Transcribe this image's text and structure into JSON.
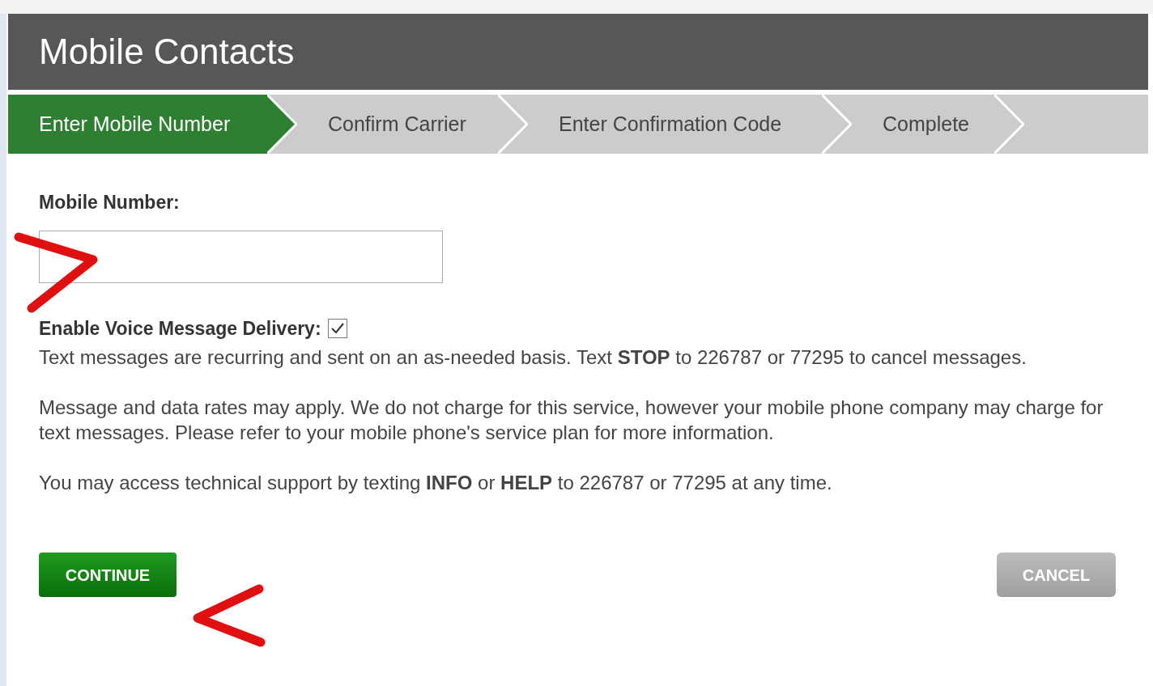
{
  "header": {
    "title": "Mobile Contacts"
  },
  "steps": [
    {
      "label": "Enter Mobile Number",
      "selected": true
    },
    {
      "label": "Confirm Carrier",
      "selected": false
    },
    {
      "label": "Enter Confirmation Code",
      "selected": false
    },
    {
      "label": "Complete",
      "selected": false
    }
  ],
  "mobile_number": {
    "label": "Mobile Number:"
  },
  "voice_delivery": {
    "label": "Enable Voice Message Delivery:",
    "checked": true
  },
  "paragraphs": [
    "Text messages are recurring and sent on an as-needed basis. Text **STOP** to 226787 or 77295 to cancel messages.",
    "Message and data rates may apply. We do not charge for this service, however your mobile phone company may charge for text messages. Please refer to your mobile phone's service plan for more information.",
    "You may access technical support by texting **INFO** or **HELP** to 226787 or 77295 at any time."
  ],
  "buttons": {
    "continue": "CONTINUE",
    "cancel": "CANCEL"
  }
}
